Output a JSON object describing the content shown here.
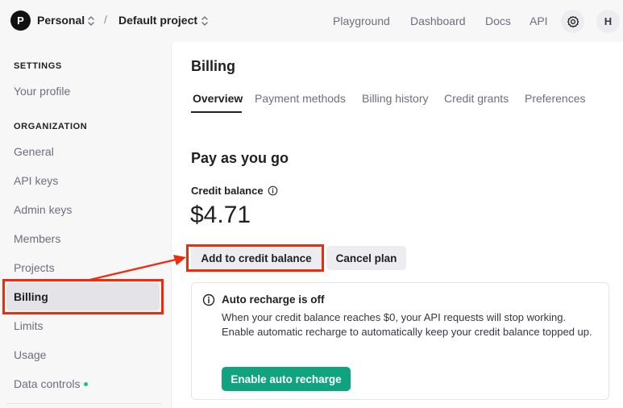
{
  "topbar": {
    "org_initial": "P",
    "org_name": "Personal",
    "separator": "/",
    "project_name": "Default project",
    "nav": [
      "Playground",
      "Dashboard",
      "Docs",
      "API"
    ],
    "user_initial": "H",
    "icons": {
      "settings": "gear-icon",
      "switcher": "chevron-up-down-icon"
    }
  },
  "sidebar": {
    "settings_heading": "SETTINGS",
    "your_profile": "Your profile",
    "organization_heading": "ORGANIZATION",
    "items": [
      "General",
      "API keys",
      "Admin keys",
      "Members",
      "Projects",
      "Billing",
      "Limits",
      "Usage",
      "Data controls"
    ],
    "active_item": "Billing",
    "status_dot_color": "#19c37d"
  },
  "main": {
    "title": "Billing",
    "tabs": [
      "Overview",
      "Payment methods",
      "Billing history",
      "Credit grants",
      "Preferences"
    ],
    "active_tab": "Overview",
    "section_title": "Pay as you go",
    "credit_label": "Credit balance",
    "credit_value": "$4.71",
    "add_credit_button": "Add to credit balance",
    "cancel_plan_button": "Cancel plan",
    "recharge": {
      "title": "Auto recharge is off",
      "body": "When your credit balance reaches $0, your API requests will stop working. Enable automatic recharge to automatically keep your credit balance topped up.",
      "enable_button": "Enable auto recharge",
      "button_color": "#10a37f"
    }
  },
  "annotation": {
    "color": "#f02b0b"
  }
}
